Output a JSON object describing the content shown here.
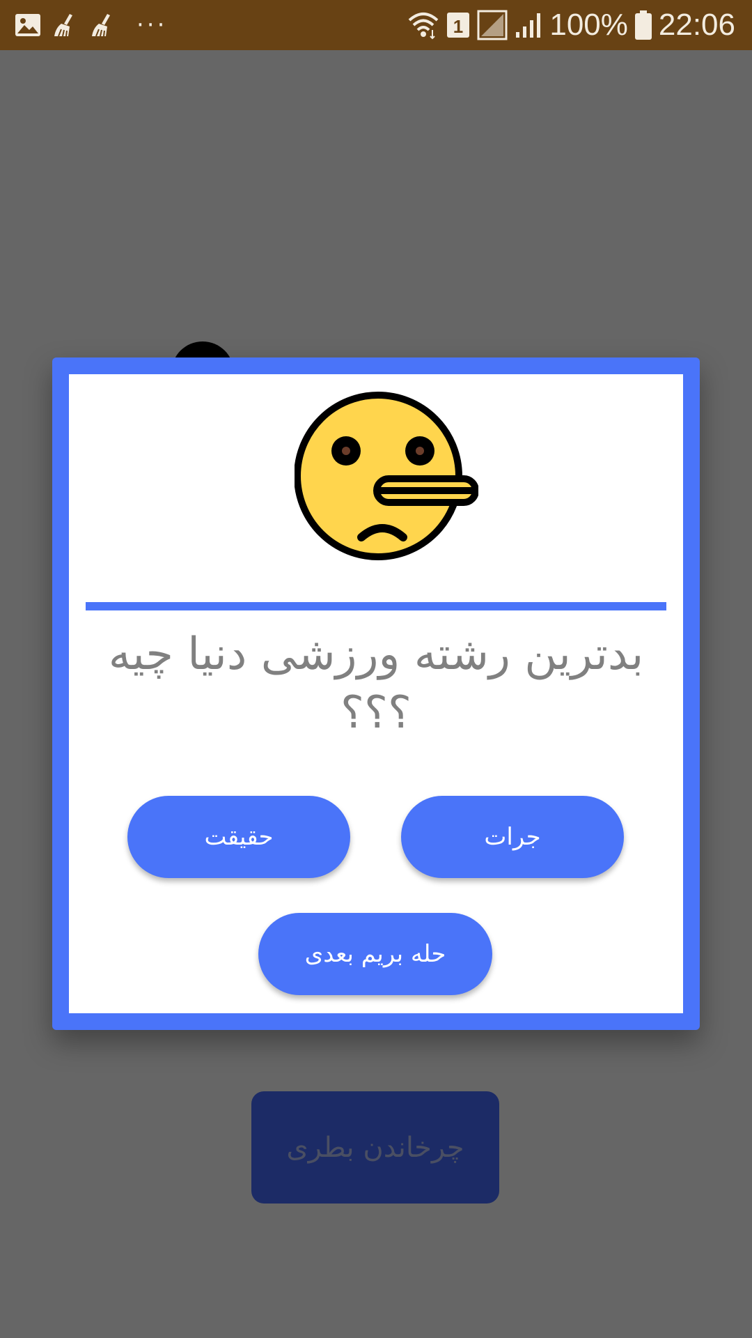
{
  "status_bar": {
    "left_icons": [
      "gallery-icon",
      "broom-icon",
      "broom-icon"
    ],
    "more_label": "···",
    "sim_badge": "1",
    "battery_percent": "100%",
    "time": "22:06"
  },
  "dialog": {
    "emoji_icon": "lying-face-emoji",
    "question": "بدترین رشته ورزشی دنیا چیه ؟؟؟",
    "buttons": {
      "truth": "حقیقت",
      "dare": "جرات",
      "next": "حله بریم بعدی"
    }
  },
  "background": {
    "spin_button": "چرخاندن بطری"
  },
  "colors": {
    "status_bar": "#684214",
    "accent": "#4a74f9",
    "overlay": "#666666",
    "question_text": "#808080"
  }
}
